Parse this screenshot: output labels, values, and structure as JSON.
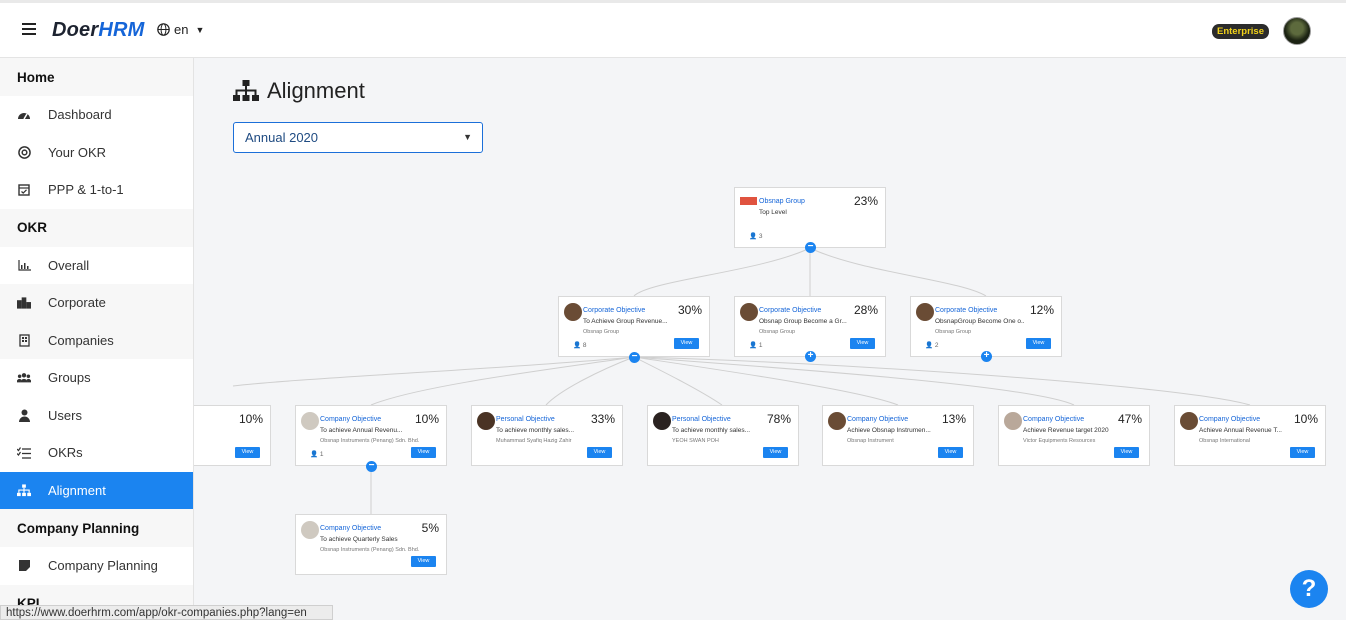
{
  "header": {
    "logo_primary": "Doer",
    "logo_accent": "HRM",
    "language": "en",
    "plan_badge": "Enterprise"
  },
  "sidebar": {
    "sections": [
      {
        "heading": "Home",
        "items": [
          {
            "label": "Dashboard",
            "icon": "tachometer-icon"
          },
          {
            "label": "Your OKR",
            "icon": "target-icon"
          },
          {
            "label": "PPP & 1-to-1",
            "icon": "calendar-check-icon"
          }
        ]
      },
      {
        "heading": "OKR",
        "items": [
          {
            "label": "Overall",
            "icon": "bar-chart-icon"
          },
          {
            "label": "Corporate",
            "icon": "city-icon"
          },
          {
            "label": "Companies",
            "icon": "building-icon"
          },
          {
            "label": "Groups",
            "icon": "users-icon"
          },
          {
            "label": "Users",
            "icon": "user-icon"
          },
          {
            "label": "OKRs",
            "icon": "list-check-icon"
          },
          {
            "label": "Alignment",
            "icon": "sitemap-icon",
            "active": true
          }
        ]
      },
      {
        "heading": "Company Planning",
        "items": [
          {
            "label": "Company Planning",
            "icon": "square-icon"
          }
        ]
      },
      {
        "heading": "KPI",
        "items": []
      }
    ]
  },
  "status_bar": {
    "url": "https://www.doerhrm.com/app/okr-companies.php?lang=en"
  },
  "main": {
    "title": "Alignment",
    "period_select": "Annual 2020"
  },
  "tree": {
    "nodes": [
      {
        "id": "root",
        "type": "Obsnap Group",
        "desc": "Top Level",
        "org": "",
        "count": "3",
        "percent": "23%",
        "view": "",
        "toggle": "minus"
      },
      {
        "id": "c1",
        "type": "Corporate Objective",
        "desc": "To Achieve Group Revenue...",
        "org": "Obsnap Group",
        "count": "8",
        "percent": "30%",
        "view": "View",
        "toggle": "minus"
      },
      {
        "id": "c2",
        "type": "Corporate Objective",
        "desc": "Obsnap Group Become a Gr...",
        "org": "Obsnap Group",
        "count": "1",
        "percent": "28%",
        "view": "View",
        "toggle": "plus"
      },
      {
        "id": "c3",
        "type": "Corporate Objective",
        "desc": "ObsnapGroup Become One o...",
        "org": "Obsnap Group",
        "count": "2",
        "percent": "12%",
        "view": "View",
        "toggle": "plus"
      },
      {
        "id": "l0",
        "type": "",
        "desc": "",
        "org": "",
        "count": "",
        "percent": "10%",
        "view": "View",
        "toggle": ""
      },
      {
        "id": "l1",
        "type": "Company Objective",
        "desc": "To achieve Annual Revenu...",
        "org": "Obsnap Instruments (Penang) Sdn. Bhd.",
        "count": "1",
        "percent": "10%",
        "view": "View",
        "toggle": "minus"
      },
      {
        "id": "l2",
        "type": "Personal Objective",
        "desc": "To achieve monthly sales...",
        "org": "Muhammad Syafiq Hazig Zahir",
        "count": "",
        "percent": "33%",
        "view": "View",
        "toggle": ""
      },
      {
        "id": "l3",
        "type": "Personal Objective",
        "desc": "To achieve monthly sales...",
        "org": "YEOH SWAN POH",
        "count": "",
        "percent": "78%",
        "view": "View",
        "toggle": ""
      },
      {
        "id": "l4",
        "type": "Company Objective",
        "desc": "Achieve Obsnap Instrumen...",
        "org": "Obsnap Instrument",
        "count": "",
        "percent": "13%",
        "view": "View",
        "toggle": ""
      },
      {
        "id": "l5",
        "type": "Company Objective",
        "desc": "Achieve Revenue target 2020",
        "org": "Victor Equipments Resources",
        "count": "",
        "percent": "47%",
        "view": "View",
        "toggle": ""
      },
      {
        "id": "l6",
        "type": "Company Objective",
        "desc": "Achieve Annual Revenue T...",
        "org": "Obsnap International",
        "count": "",
        "percent": "10%",
        "view": "View",
        "toggle": ""
      },
      {
        "id": "s1",
        "type": "Company Objective",
        "desc": "To achieve Quarterly Sales",
        "org": "Obsnap Instruments (Penang) Sdn. Bhd.",
        "count": "",
        "percent": "5%",
        "view": "View",
        "toggle": ""
      }
    ]
  },
  "help_button": "?"
}
